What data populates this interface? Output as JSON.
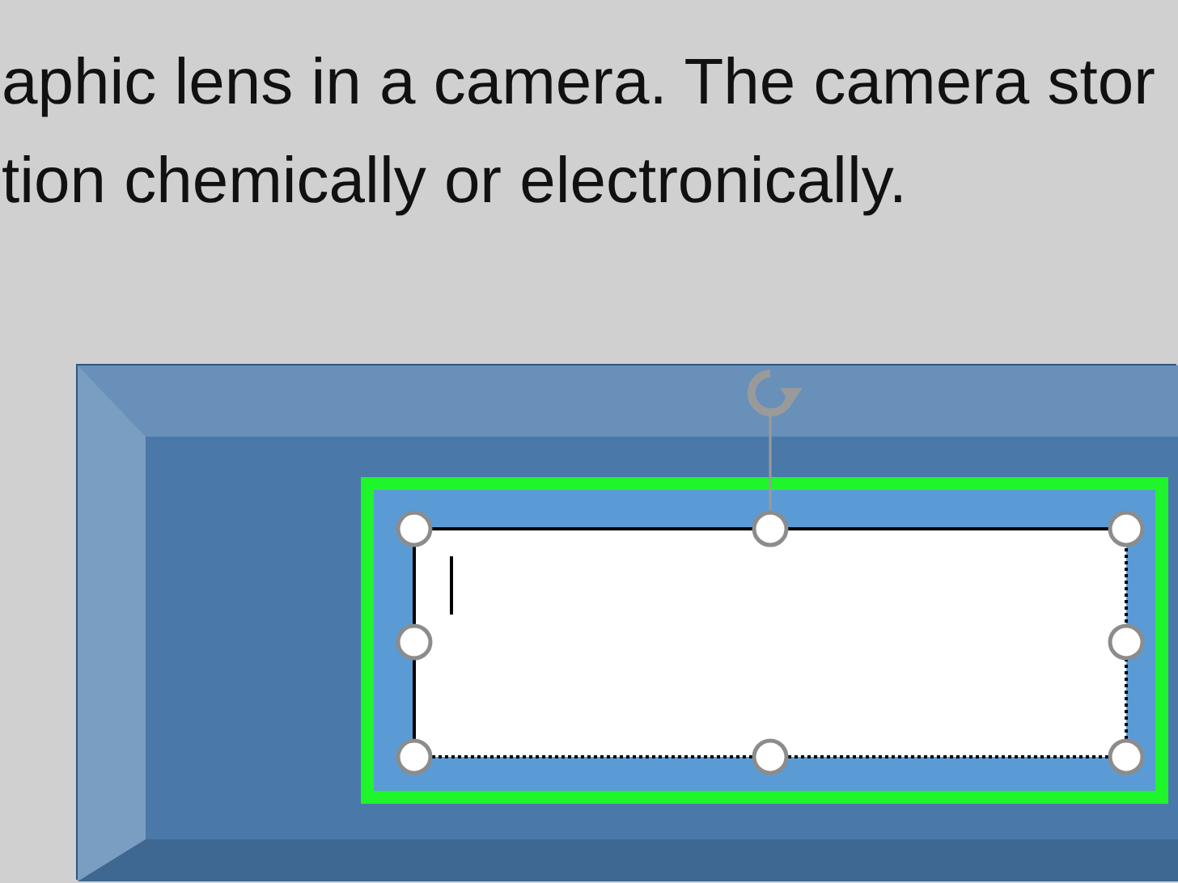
{
  "document": {
    "lines": [
      "aphic lens in a camera. The camera stor",
      "tion chemically or electronically."
    ]
  },
  "shape": {
    "kind": "bevel"
  },
  "text_box": {
    "selected": true,
    "editing": true
  }
}
